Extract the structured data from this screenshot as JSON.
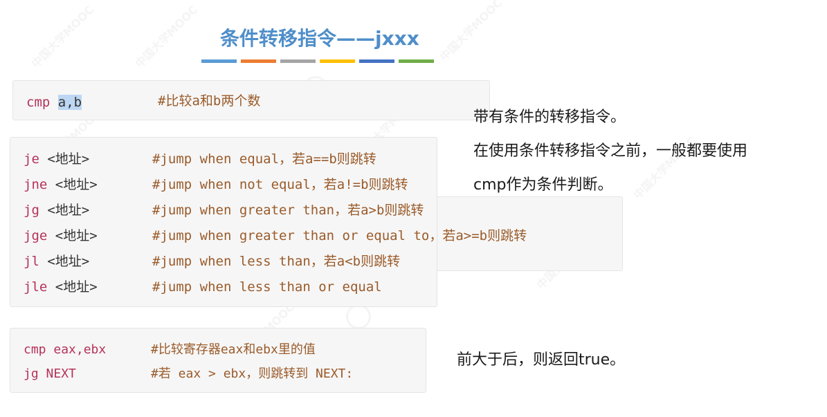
{
  "slide": {
    "title": "条件转移指令——jxxx",
    "bar_colors": [
      "#5a9bd5",
      "#ed7d31",
      "#a5a5a5",
      "#ffc000",
      "#4472c4",
      "#70ad47"
    ]
  },
  "code_block_1": {
    "line": {
      "instr": "cmp",
      "operand_sel": "a,b",
      "comment": "#比较a和b两个数"
    }
  },
  "code_block_2": {
    "lines": [
      {
        "instr": "je",
        "operand": "<地址>",
        "comment": "#jump when equal，若a==b则跳转"
      },
      {
        "instr": "jne",
        "operand": "<地址>",
        "comment": "#jump when not equal，若a!=b则跳转"
      },
      {
        "instr": "jg",
        "operand": "<地址>",
        "comment": "#jump when greater than，若a>b则跳转"
      },
      {
        "instr": "jge",
        "operand": "<地址>",
        "comment": "#jump when greater than or equal to，若a>=b则跳转"
      },
      {
        "instr": "jl",
        "operand": "<地址>",
        "comment": "#jump when less than，若a<b则跳转"
      },
      {
        "instr": "jle",
        "operand": "<地址>",
        "comment": "#jump when less than or equal"
      }
    ]
  },
  "code_block_3": {
    "lines": [
      {
        "instr": "cmp",
        "operand": "eax,ebx",
        "comment": "#比较寄存器eax和ebx里的值"
      },
      {
        "instr": "jg",
        "operand": "NEXT",
        "comment": "#若 eax > ebx，则跳转到 NEXT:"
      }
    ]
  },
  "notes": {
    "line1": "带有条件的转移指令。",
    "line2": "在使用条件转移指令之前，一般都要使用",
    "line3": "cmp作为条件判断。",
    "line4": "前大于后，则返回true。"
  },
  "watermark": {
    "text": "中国大学MOOC"
  }
}
